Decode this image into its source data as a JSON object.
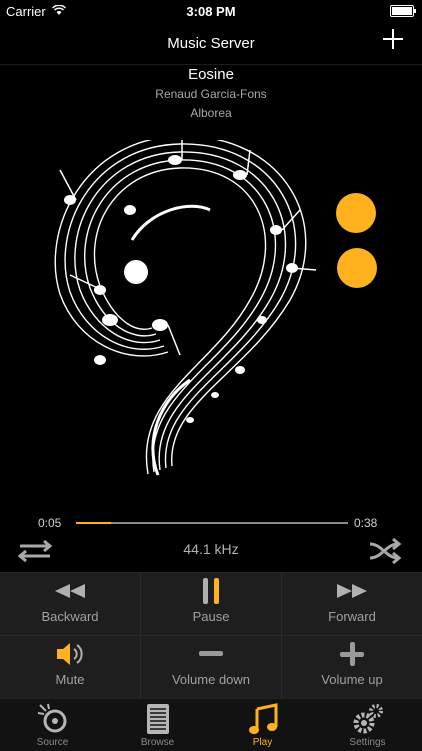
{
  "status_bar": {
    "carrier": "Carrier",
    "time": "3:08 PM"
  },
  "nav": {
    "title": "Music Server"
  },
  "track": {
    "title": "Eosine",
    "artist": "Renaud Garcia-Fons",
    "album": "Alborea"
  },
  "playback": {
    "elapsed": "0:05",
    "total": "0:38",
    "progress": 0.13,
    "sample_rate": "44.1 kHz"
  },
  "controls": {
    "backward": "Backward",
    "pause": "Pause",
    "forward": "Forward",
    "mute": "Mute",
    "volume_down": "Volume down",
    "volume_up": "Volume up"
  },
  "tabs": [
    {
      "label": "Source",
      "icon": "source-icon",
      "active": false
    },
    {
      "label": "Browse",
      "icon": "browse-icon",
      "active": false
    },
    {
      "label": "Play",
      "icon": "music-note-icon",
      "active": true
    },
    {
      "label": "Settings",
      "icon": "gear-icon",
      "active": false
    }
  ],
  "colors": {
    "accent": "#ffb21e",
    "background": "#000000",
    "grid": "#1e1e1e"
  }
}
